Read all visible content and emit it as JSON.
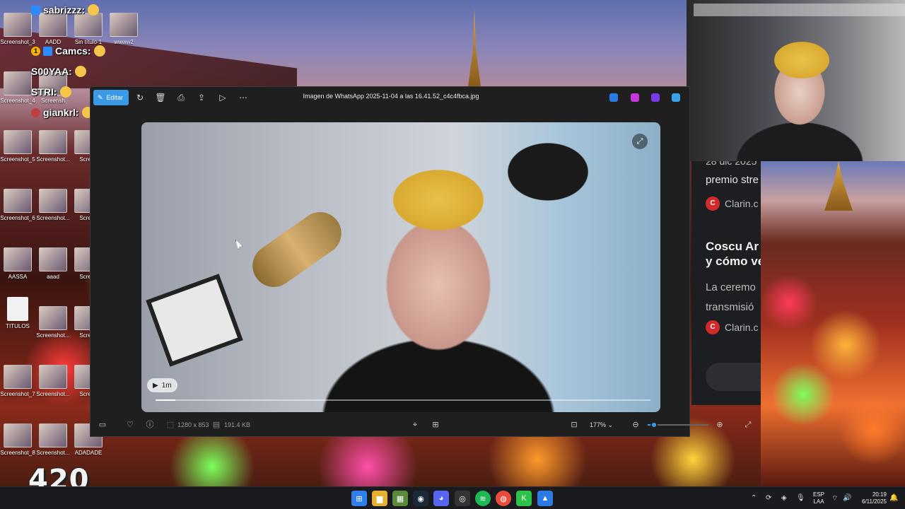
{
  "desktop": {
    "icons": [
      {
        "label": "Screenshot_3"
      },
      {
        "label": "AADD"
      },
      {
        "label": "Sin título-1"
      },
      {
        "label": "wwww2"
      },
      {
        "label": "Screenshot_4"
      },
      {
        "label": "Screensh"
      },
      {
        "label": "Screenshot_5"
      },
      {
        "label": "Screenshot..."
      },
      {
        "label": "Screen"
      },
      {
        "label": "Screenshot_6"
      },
      {
        "label": "Screenshot..."
      },
      {
        "label": "Screen"
      },
      {
        "label": "AASSA"
      },
      {
        "label": "aaad"
      },
      {
        "label": "Screen"
      },
      {
        "label": "TITULOS"
      },
      {
        "label": "Screenshot..."
      },
      {
        "label": "Screen"
      },
      {
        "label": "Screenshot_7"
      },
      {
        "label": "Screenshot..."
      },
      {
        "label": "Screen"
      },
      {
        "label": "Screenshot_8"
      },
      {
        "label": "Screenshot..."
      },
      {
        "label": "ADADADE"
      }
    ],
    "watermark": "420"
  },
  "chat": [
    {
      "user": "sabrizzz:",
      "badge": ""
    },
    {
      "user": "Camcs:",
      "badge": "1"
    },
    {
      "user": "S00YAA:",
      "badge": ""
    },
    {
      "user": "STRI:",
      "badge": ""
    },
    {
      "user": "giankrl:",
      "badge": ""
    }
  ],
  "viewer": {
    "edit_label": "Editar",
    "title": "Imagen de WhatsApp 2025-11-04 a las 16.41.52_c4c4fbca.jpg",
    "video_duration": "1m",
    "progress": 0.04,
    "dimensions": "1280 x 853",
    "file_size": "191.4 KB",
    "zoom": "177%",
    "zoom_level": 0.1,
    "colors": {
      "accent": "#3b9ae8",
      "bg": "#1f1f1f"
    }
  },
  "article": {
    "date": "28 dic 2025",
    "line1": "premio stre",
    "source1": "Clarin.c",
    "headline_1": "Coscu Ar",
    "headline_2": "y cómo ve",
    "para_1": "La ceremo",
    "para_2": "transmisió",
    "source2": "Clarin.c"
  },
  "taskbar": {
    "lang_top": "ESP",
    "lang_bottom": "LAA",
    "time": "20:19",
    "date": "6/11/2025"
  }
}
